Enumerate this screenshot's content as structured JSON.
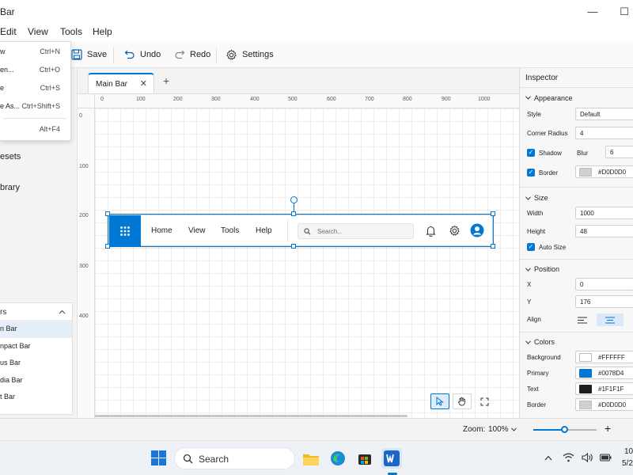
{
  "window": {
    "title": "Bar",
    "minimize": "—",
    "maximize": "☐"
  },
  "menubar": {
    "items": [
      "Edit",
      "View",
      "Tools",
      "Help"
    ]
  },
  "toolbar": {
    "save": "Save",
    "undo": "Undo",
    "redo": "Redo",
    "settings": "Settings"
  },
  "file_menu": {
    "items": [
      {
        "label": "w",
        "shortcut": "Ctrl+N"
      },
      {
        "label": "en...",
        "shortcut": "Ctrl+O"
      },
      {
        "label": "e",
        "shortcut": "Ctrl+S"
      },
      {
        "label": "e As...",
        "shortcut": "Ctrl+Shift+S"
      },
      {
        "label": "",
        "shortcut": "Alt+F4"
      }
    ]
  },
  "sidebar": {
    "items": [
      "esets",
      "brary"
    ],
    "layers_header": "rs",
    "layers": [
      "n Bar",
      "npact Bar",
      "us Bar",
      "dia Bar",
      "t Bar"
    ]
  },
  "tabs": {
    "active": "Main Bar",
    "close": "✕",
    "add": "+"
  },
  "ruler": {
    "top": [
      "0",
      "100",
      "200",
      "300",
      "400",
      "500",
      "600",
      "700",
      "800",
      "900",
      "1000"
    ],
    "left": [
      "0",
      "100",
      "200",
      "300",
      "400"
    ]
  },
  "design": {
    "nav": [
      "Home",
      "View",
      "Tools",
      "Help"
    ],
    "search_placeholder": "Search..."
  },
  "inspector": {
    "title": "Inspector",
    "appearance": {
      "header": "Appearance",
      "style_label": "Style",
      "style_value": "Default",
      "corner_label": "Corner Radius",
      "corner_value": "4",
      "shadow_label": "Shadow",
      "blur_label": "Blur",
      "blur_value": "6",
      "border_label": "Border",
      "border_value": "#D0D0D0"
    },
    "size": {
      "header": "Size",
      "width_label": "Width",
      "width_value": "1000",
      "height_label": "Height",
      "height_value": "48",
      "auto_label": "Auto Size"
    },
    "position": {
      "header": "Position",
      "x_label": "X",
      "x_value": "0",
      "y_label": "Y",
      "y_value": "176",
      "align_label": "Align"
    },
    "colors": {
      "header": "Colors",
      "background_label": "Background",
      "background_value": "#FFFFFF",
      "primary_label": "Primary",
      "primary_value": "#0078D4",
      "text_label": "Text",
      "text_value": "#1F1F1F",
      "border_label": "Border",
      "border_value": "#D0D0D0"
    }
  },
  "statusbar": {
    "zoom_label": "Zoom:",
    "zoom_value": "100%",
    "zoom_slider_fraction": 0.5,
    "plus": "+"
  },
  "taskbar": {
    "search": "Search",
    "time": "10",
    "date": "5/2"
  },
  "colors": {
    "accent": "#0078D4",
    "background": "#FFFFFF",
    "text": "#1F1F1F",
    "border": "#D0D0D0"
  }
}
